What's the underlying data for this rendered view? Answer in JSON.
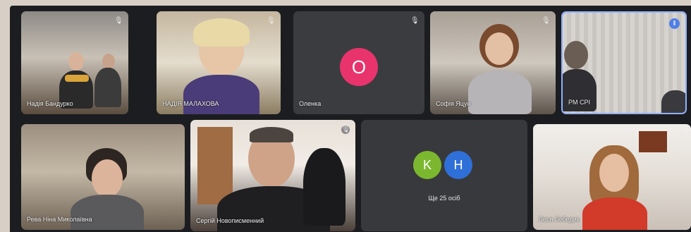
{
  "meeting": {
    "tiles": [
      {
        "name": "Надія Бандурко",
        "muted": true
      },
      {
        "name": "НАДІЯ МАЛАХОВА",
        "muted": true
      },
      {
        "name": "Оленка",
        "muted": true,
        "avatar_letter": "O",
        "avatar_color": "#e8336d"
      },
      {
        "name": "Софія Яцун",
        "muted": true
      },
      {
        "name": "PM CPI",
        "speaking": true
      },
      {
        "name": "Рева Ніна Миколаївна",
        "muted": false
      },
      {
        "name": "Сергій Новописменний",
        "muted": true
      },
      {
        "name": "Леся Лебедик",
        "muted": true
      }
    ],
    "overflow": {
      "label": "Ще 25 осіб",
      "avatars": [
        {
          "letter": "K",
          "color": "#7cb82f"
        },
        {
          "letter": "H",
          "color": "#2f6fd8"
        }
      ]
    }
  },
  "icons": {
    "mute": "mic-off-icon",
    "speaking": "audio-wave-icon"
  },
  "colors": {
    "background": "#1c1d20",
    "tile": "#3a3b3e",
    "speaking_border": "#8fb0ff"
  }
}
